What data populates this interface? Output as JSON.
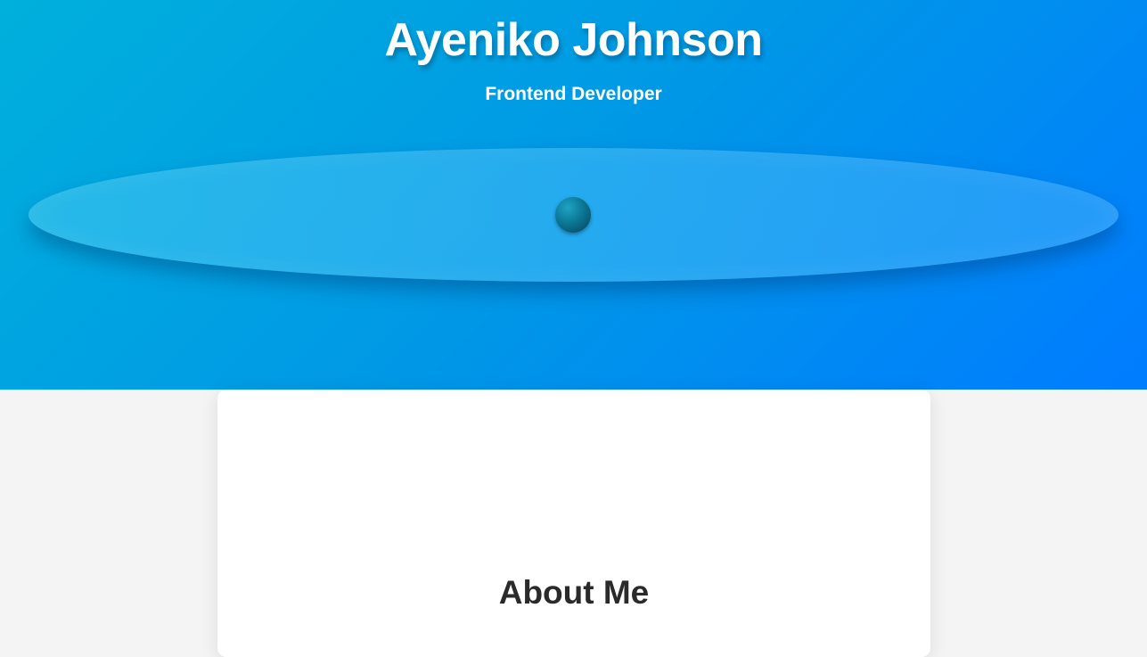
{
  "header": {
    "name": "Ayeniko Johnson",
    "role": "Frontend Developer"
  },
  "about": {
    "heading": "About Me"
  },
  "colors": {
    "hero_gradient_start": "#00b0dc",
    "hero_gradient_end": "#007cff",
    "page_background": "#f4f4f4",
    "card_background": "#ffffff",
    "heading_text": "#2a2a2a",
    "orb": "#0b7896"
  }
}
